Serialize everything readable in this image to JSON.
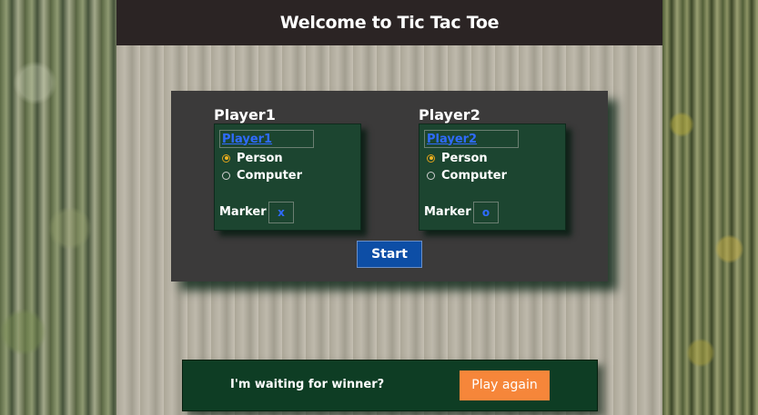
{
  "header": {
    "title": "Welcome to Tic Tac Toe"
  },
  "players": [
    {
      "heading": "Player1",
      "name_value": "Player1",
      "options": [
        "Person",
        "Computer"
      ],
      "selected": "Person",
      "marker_label": "Marker",
      "marker_value": "x"
    },
    {
      "heading": "Player2",
      "name_value": "Player2",
      "options": [
        "Person",
        "Computer"
      ],
      "selected": "Person",
      "marker_label": "Marker",
      "marker_value": "o"
    }
  ],
  "start_button": {
    "label": "Start"
  },
  "status": {
    "message": "I'm waiting for winner?",
    "play_again_label": "Play again"
  },
  "colors": {
    "header_bg": "#2b2424",
    "panel_bg": "#3b3a3a",
    "player_box_bg": "#1c4530",
    "start_button": "#0d4ea6",
    "play_again_button": "#f6863a",
    "status_bar": "#0e3d24",
    "radio_selected": "#f1b521",
    "input_text": "#2f6bff"
  }
}
